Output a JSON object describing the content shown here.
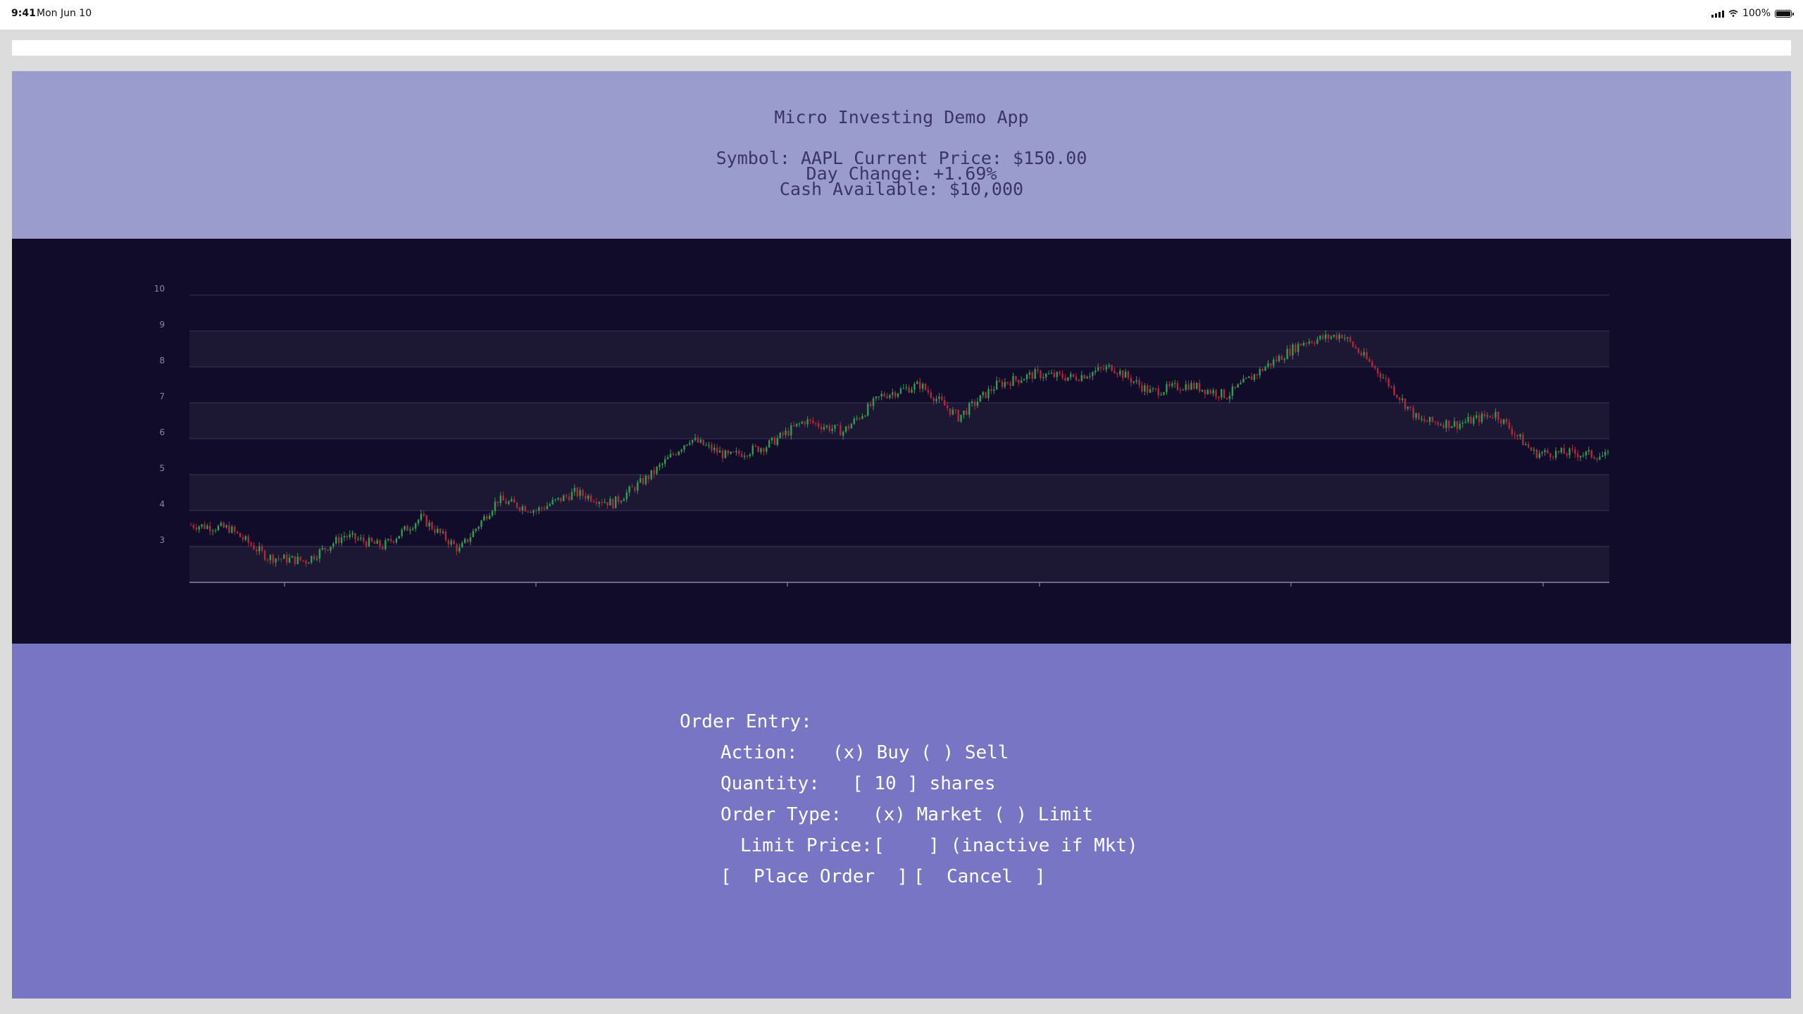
{
  "status_bar": {
    "time": "9:41",
    "date": "Mon Jun 10",
    "battery": "100%"
  },
  "header": {
    "title": "Micro Investing Demo App",
    "symbol_line": "Symbol: AAPL Current Price: $150.00",
    "change_line": "Day Change: +1.69%",
    "cash_line": "Cash Available: $10,000"
  },
  "chart_data": {
    "type": "candlestick",
    "y_ticks": [
      "3",
      "4",
      "5",
      "6",
      "7",
      "8",
      "9",
      "10"
    ],
    "ylim": [
      2,
      10
    ],
    "grid": true,
    "colors": {
      "up": "#2e9e4f",
      "down": "#b3283b",
      "band": "#1c1733",
      "gridline": "#3a3556",
      "axis": "#8a86a8"
    },
    "trend": [
      3.6,
      3.5,
      2.7,
      2.6,
      3.3,
      3.0,
      3.8,
      2.9,
      4.3,
      4.0,
      4.5,
      4.2,
      5.0,
      6.0,
      5.5,
      5.8,
      6.5,
      6.2,
      7.2,
      7.5,
      6.6,
      7.5,
      7.8,
      7.7,
      8.0,
      7.3,
      7.5,
      7.2,
      8.0,
      8.7,
      8.9,
      7.8,
      6.5,
      6.4,
      6.7,
      5.6,
      5.6,
      5.5
    ],
    "candles_per_segment": 14
  },
  "order": {
    "heading": "Order Entry:",
    "action_label": "Action:",
    "action_options": "(x) Buy ( ) Sell",
    "quantity_label": "Quantity:",
    "quantity_value": "[ 10 ] shares",
    "type_label": "Order Type:",
    "type_options": "(x) Market ( ) Limit",
    "limit_label": "Limit Price:",
    "limit_value": "[    ] (inactive if Mkt)",
    "place_button": "[  Place Order  ]",
    "cancel_button": "[  Cancel  ]"
  }
}
